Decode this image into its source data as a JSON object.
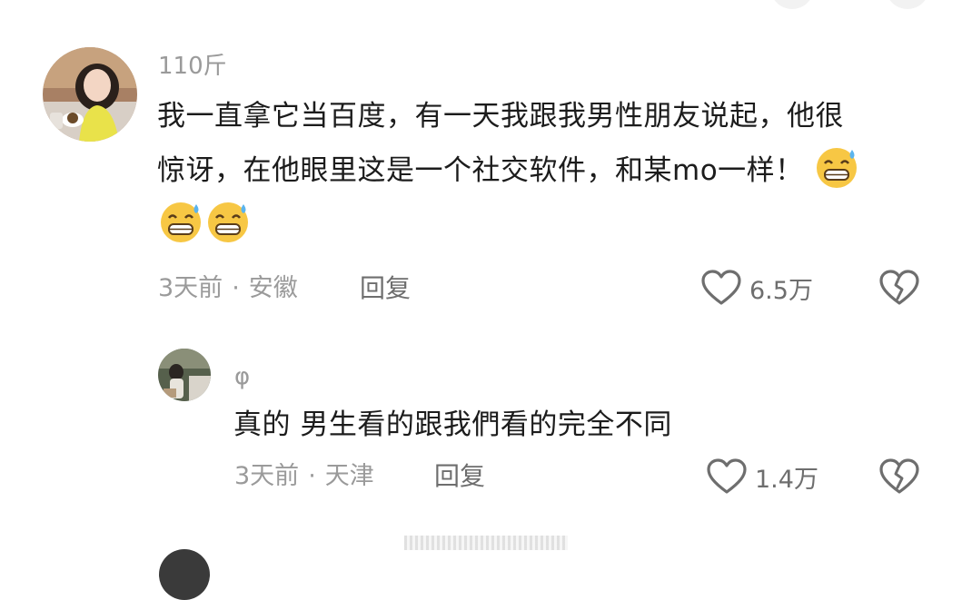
{
  "comment": {
    "username": "110斤",
    "text_line1": "我一直拿它当百度，有一天我跟我男性朋友说起，他很",
    "text_line2": "惊讶，在他眼里这是一个社交软件，和某mo一样！",
    "emoji": "sweat-grin-emoji",
    "time": "3天前",
    "separator": "·",
    "location": "安徽",
    "reply_label": "回复",
    "like_count": "6.5万"
  },
  "reply": {
    "username": "φ",
    "text": "真的 男生看的跟我們看的完全不同",
    "time": "3天前",
    "separator": "·",
    "location": "天津",
    "reply_label": "回复",
    "like_count": "1.4万"
  },
  "colors": {
    "meta_gray": "#9a9a9a",
    "action_gray": "#6e6e6e",
    "text": "#1c1c1c",
    "background": "#ffffff"
  },
  "icons": {
    "like": "heart-outline-icon",
    "dislike": "broken-heart-icon"
  }
}
